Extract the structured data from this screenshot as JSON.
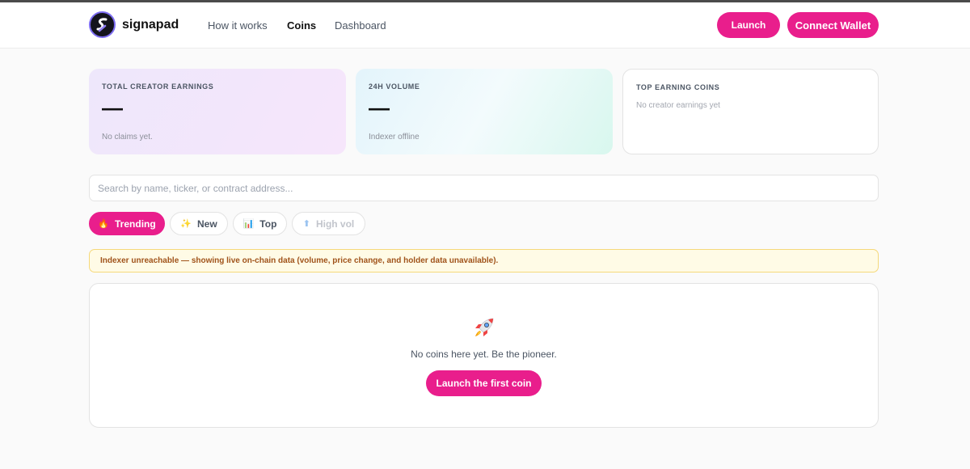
{
  "brand": {
    "name": "signapad"
  },
  "nav": {
    "items": [
      "How it works",
      "Coins",
      "Dashboard"
    ]
  },
  "header": {
    "launch_label": "Launch",
    "connect_label": "Connect Wallet"
  },
  "stats": {
    "creator_earnings": {
      "label": "TOTAL CREATOR EARNINGS",
      "value": "—",
      "note": "No claims yet."
    },
    "volume": {
      "label": "24H VOLUME",
      "value": "—",
      "note": "Indexer offline"
    },
    "top_coins": {
      "label": "TOP EARNING COINS",
      "note": "No creator earnings yet"
    }
  },
  "search": {
    "placeholder": "Search by name, ticker, or contract address..."
  },
  "filters": [
    {
      "label": "Trending",
      "icon": "fire-icon",
      "glyph": "🔥"
    },
    {
      "label": "New",
      "icon": "sparkles-icon",
      "glyph": "✨"
    },
    {
      "label": "Top",
      "icon": "bar-chart-icon",
      "glyph": "📊"
    },
    {
      "label": "High vol",
      "icon": "arrow-up-icon",
      "glyph": "⬆"
    }
  ],
  "banner": {
    "text": "Indexer unreachable — showing live on-chain data (volume, price change, and holder data unavailable)."
  },
  "empty_state": {
    "icon": "rocket-icon",
    "text": "No coins here yet. Be the pioneer.",
    "button_label": "Launch the first coin"
  },
  "colors": {
    "accent": "#e91e8c",
    "warning_bg": "#fffbe6",
    "warning_text": "#a0531a"
  }
}
